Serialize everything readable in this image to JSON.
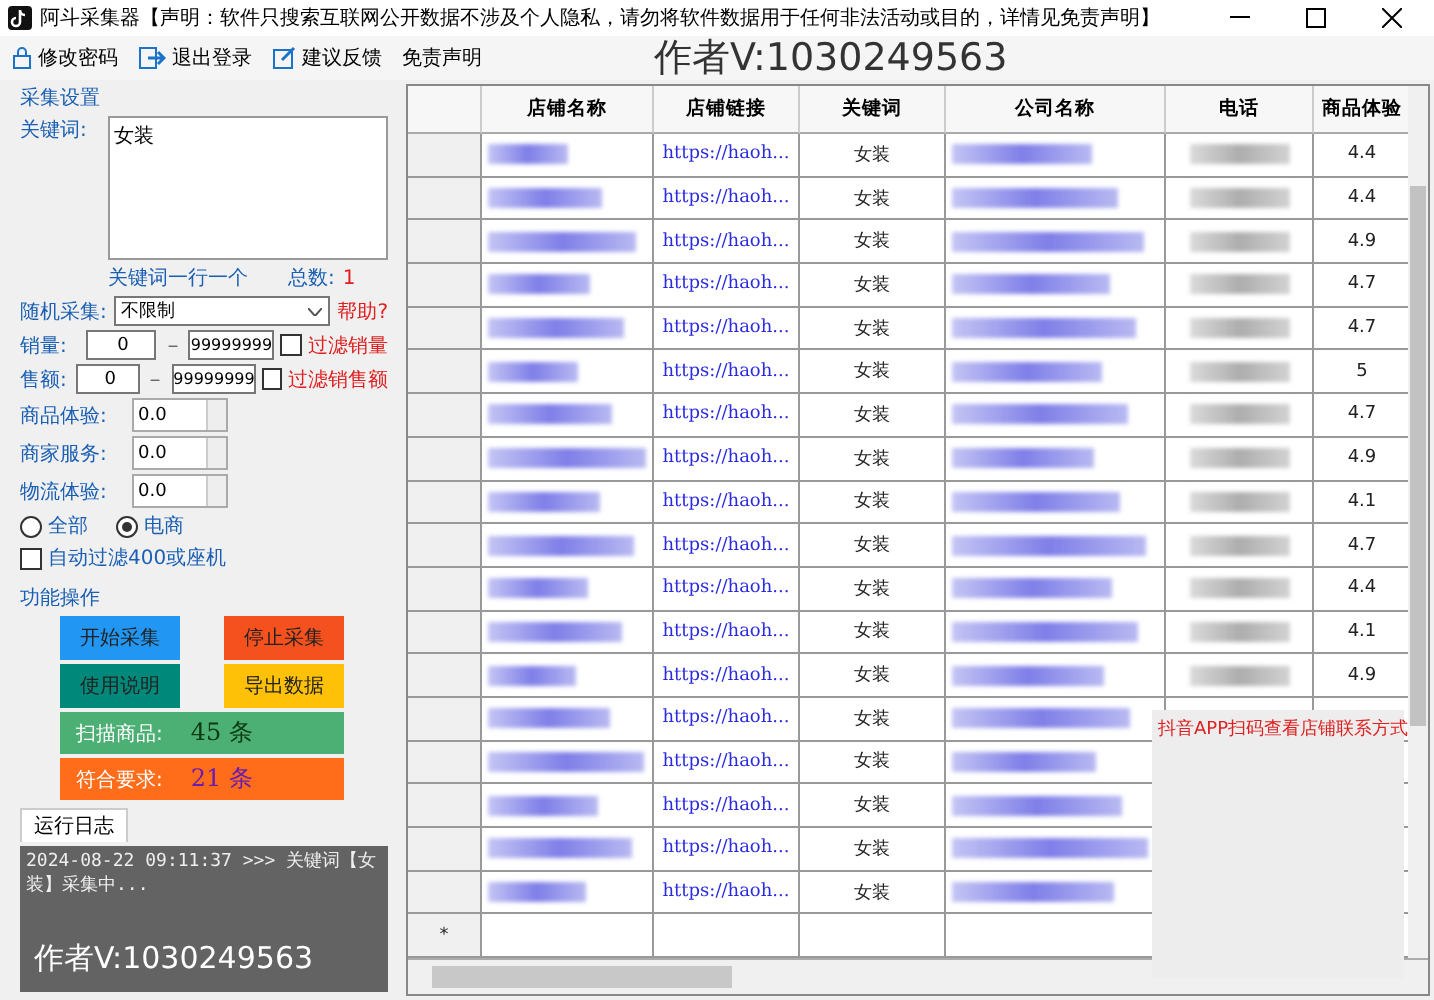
{
  "window": {
    "title": "阿斗采集器【声明：软件只搜索互联网公开数据不涉及个人隐私，请勿将软件数据用于任何非法活动或目的，详情见免责声明】"
  },
  "toolbar": {
    "items": [
      {
        "label": "修改密码"
      },
      {
        "label": "退出登录"
      },
      {
        "label": "建议反馈"
      },
      {
        "label": "免责声明"
      }
    ],
    "author": "作者V:1030249563"
  },
  "settings": {
    "title": "采集设置",
    "keyword_label": "关键词:",
    "keywords": "女装",
    "hint": "关键词一行一个",
    "total_label": "总数:",
    "total": "1",
    "random_label": "随机采集:",
    "random_value": "不限制",
    "help": "帮助?",
    "ranges": [
      {
        "label": "销量:",
        "min": "0",
        "dash": "－",
        "max": "99999999",
        "filter": "过滤销量",
        "checked": false
      },
      {
        "label": "售额:",
        "min": "0",
        "dash": "－",
        "max": "99999999",
        "filter": "过滤销售额",
        "checked": false
      }
    ],
    "scores": [
      {
        "label": "商品体验:",
        "value": "0.0"
      },
      {
        "label": "商家服务:",
        "value": "0.0"
      },
      {
        "label": "物流体验:",
        "value": "0.0"
      }
    ],
    "radios": [
      {
        "label": "全部",
        "selected": false
      },
      {
        "label": "电商",
        "selected": true
      }
    ],
    "auto_filter": {
      "label": "自动过滤400或座机",
      "checked": false
    }
  },
  "actions": {
    "title": "功能操作",
    "buttons": [
      {
        "label": "开始采集",
        "color": "#2196f3"
      },
      {
        "label": "停止采集",
        "color": "#f4511e"
      },
      {
        "label": "使用说明",
        "color": "#00897b"
      },
      {
        "label": "导出数据",
        "color": "#ffc107"
      }
    ],
    "stats": [
      {
        "label": "扫描商品:",
        "count": "45 条",
        "color": "#4caf73"
      },
      {
        "label": "符合要求:",
        "count": "21 条",
        "color": "#ff6d1a"
      }
    ]
  },
  "log": {
    "tab": "运行日志",
    "lines": [
      "2024-08-22 09:11:37 >>> 关键词【女装】采集中..."
    ],
    "author": "作者V:1030249563"
  },
  "table": {
    "columns": [
      "店铺名称",
      "店铺链接",
      "关键词",
      "公司名称",
      "电话",
      "商品体验"
    ],
    "rows": [
      {
        "link": "https://haoh...",
        "keyword": "女装",
        "rating": "4.4"
      },
      {
        "link": "https://haoh...",
        "keyword": "女装",
        "rating": "4.4"
      },
      {
        "link": "https://haoh...",
        "keyword": "女装",
        "rating": "4.9"
      },
      {
        "link": "https://haoh...",
        "keyword": "女装",
        "rating": "4.7"
      },
      {
        "link": "https://haoh...",
        "keyword": "女装",
        "rating": "4.7"
      },
      {
        "link": "https://haoh...",
        "keyword": "女装",
        "rating": "5"
      },
      {
        "link": "https://haoh...",
        "keyword": "女装",
        "rating": "4.7"
      },
      {
        "link": "https://haoh...",
        "keyword": "女装",
        "rating": "4.9"
      },
      {
        "link": "https://haoh...",
        "keyword": "女装",
        "rating": "4.1"
      },
      {
        "link": "https://haoh...",
        "keyword": "女装",
        "rating": "4.7"
      },
      {
        "link": "https://haoh...",
        "keyword": "女装",
        "rating": "4.4"
      },
      {
        "link": "https://haoh...",
        "keyword": "女装",
        "rating": "4.1"
      },
      {
        "link": "https://haoh...",
        "keyword": "女装",
        "rating": "4.9"
      },
      {
        "link": "https://haoh...",
        "keyword": "女装"
      },
      {
        "link": "https://haoh...",
        "keyword": "女装"
      },
      {
        "link": "https://haoh...",
        "keyword": "女装"
      },
      {
        "link": "https://haoh...",
        "keyword": "女装"
      },
      {
        "link": "https://haoh...",
        "keyword": "女装"
      }
    ],
    "new_row_marker": "*"
  },
  "popup": {
    "text": "抖音APP扫码查看店铺联系方式"
  }
}
